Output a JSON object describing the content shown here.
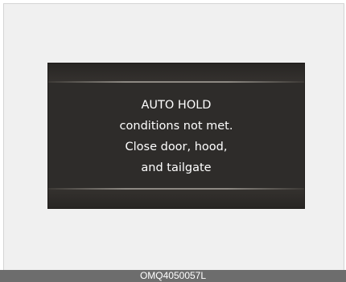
{
  "display": {
    "lines": [
      "AUTO HOLD",
      "conditions not met.",
      "Close door, hood,",
      "and tailgate"
    ]
  },
  "caption": {
    "code": "OMQ4050057L"
  }
}
